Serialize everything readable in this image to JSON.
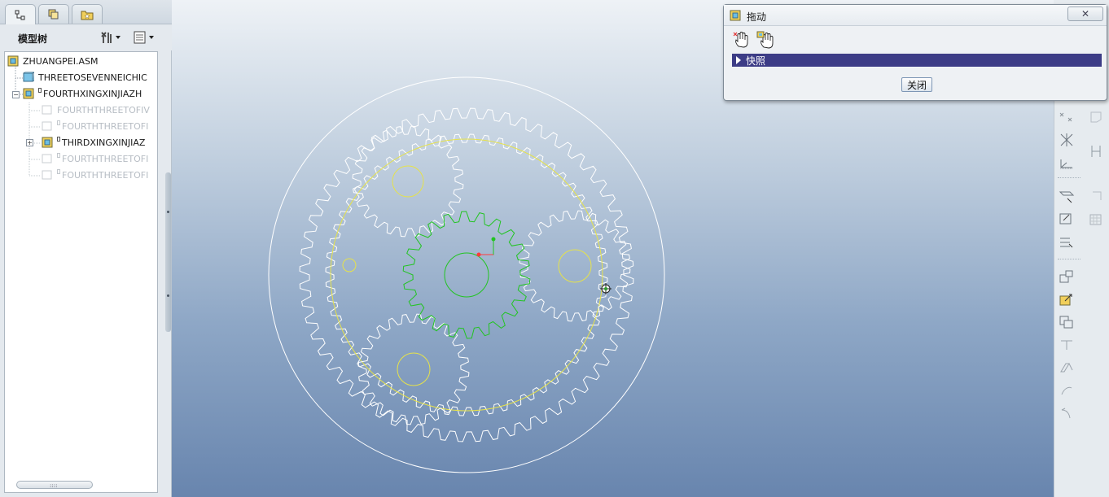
{
  "model_tree": {
    "title": "模型树",
    "rows": [
      {
        "label": "ZHUANGPEI.ASM",
        "dim": false
      },
      {
        "label": "THREETOSEVENNEICHIC",
        "dim": false
      },
      {
        "label": "FOURTHXINGXINJIAZH",
        "dim": false
      },
      {
        "label": "FOURTHTHREETOFIV",
        "dim": true
      },
      {
        "label": "FOURTHTHREETOFI",
        "dim": true
      },
      {
        "label": "THIRDXINGXINJIAZ",
        "dim": false
      },
      {
        "label": "FOURTHTHREETOFI",
        "dim": true
      },
      {
        "label": "FOURTHTHREETOFI",
        "dim": true
      }
    ],
    "scroll_grip": "::::"
  },
  "drag_dialog": {
    "title": "拖动",
    "close_x": "✕",
    "snapshot_label": "快照",
    "close_button": "关闭"
  },
  "icons": {
    "tab_model_tree": "model-tree-icon",
    "tab_layers": "layers-icon",
    "tab_favorites": "favorites-folder-icon",
    "settings": "tree-settings-icon",
    "filter": "tree-columns-icon"
  },
  "colors": {
    "selection_bar": "#3c3c86",
    "gear_lines": "#ffffff",
    "highlight_green": "#22c422",
    "pitch_yellow": "#e6e24a"
  }
}
